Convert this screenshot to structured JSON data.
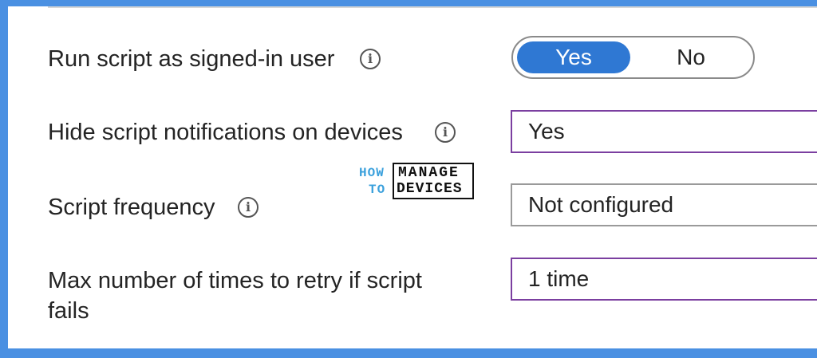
{
  "settings": {
    "run_as_user": {
      "label": "Run script as signed-in user",
      "toggle": {
        "yes_label": "Yes",
        "no_label": "No",
        "selected": "Yes"
      }
    },
    "hide_notifications": {
      "label": "Hide script notifications on devices",
      "value": "Yes"
    },
    "script_frequency": {
      "label": "Script frequency",
      "value": "Not configured"
    },
    "max_retries": {
      "label": "Max number of times to retry if script fails",
      "value": "1 time"
    }
  },
  "info_icon_glyph": "i",
  "watermark": {
    "how": "HOW",
    "to": "TO",
    "manage": "MANAGE",
    "devices": "DEVICES"
  },
  "colors": {
    "accent": "#2f78d3",
    "active_border": "#7b3fa0",
    "frame_border": "#4a90e2",
    "logo_blue": "#3aa0dc"
  }
}
